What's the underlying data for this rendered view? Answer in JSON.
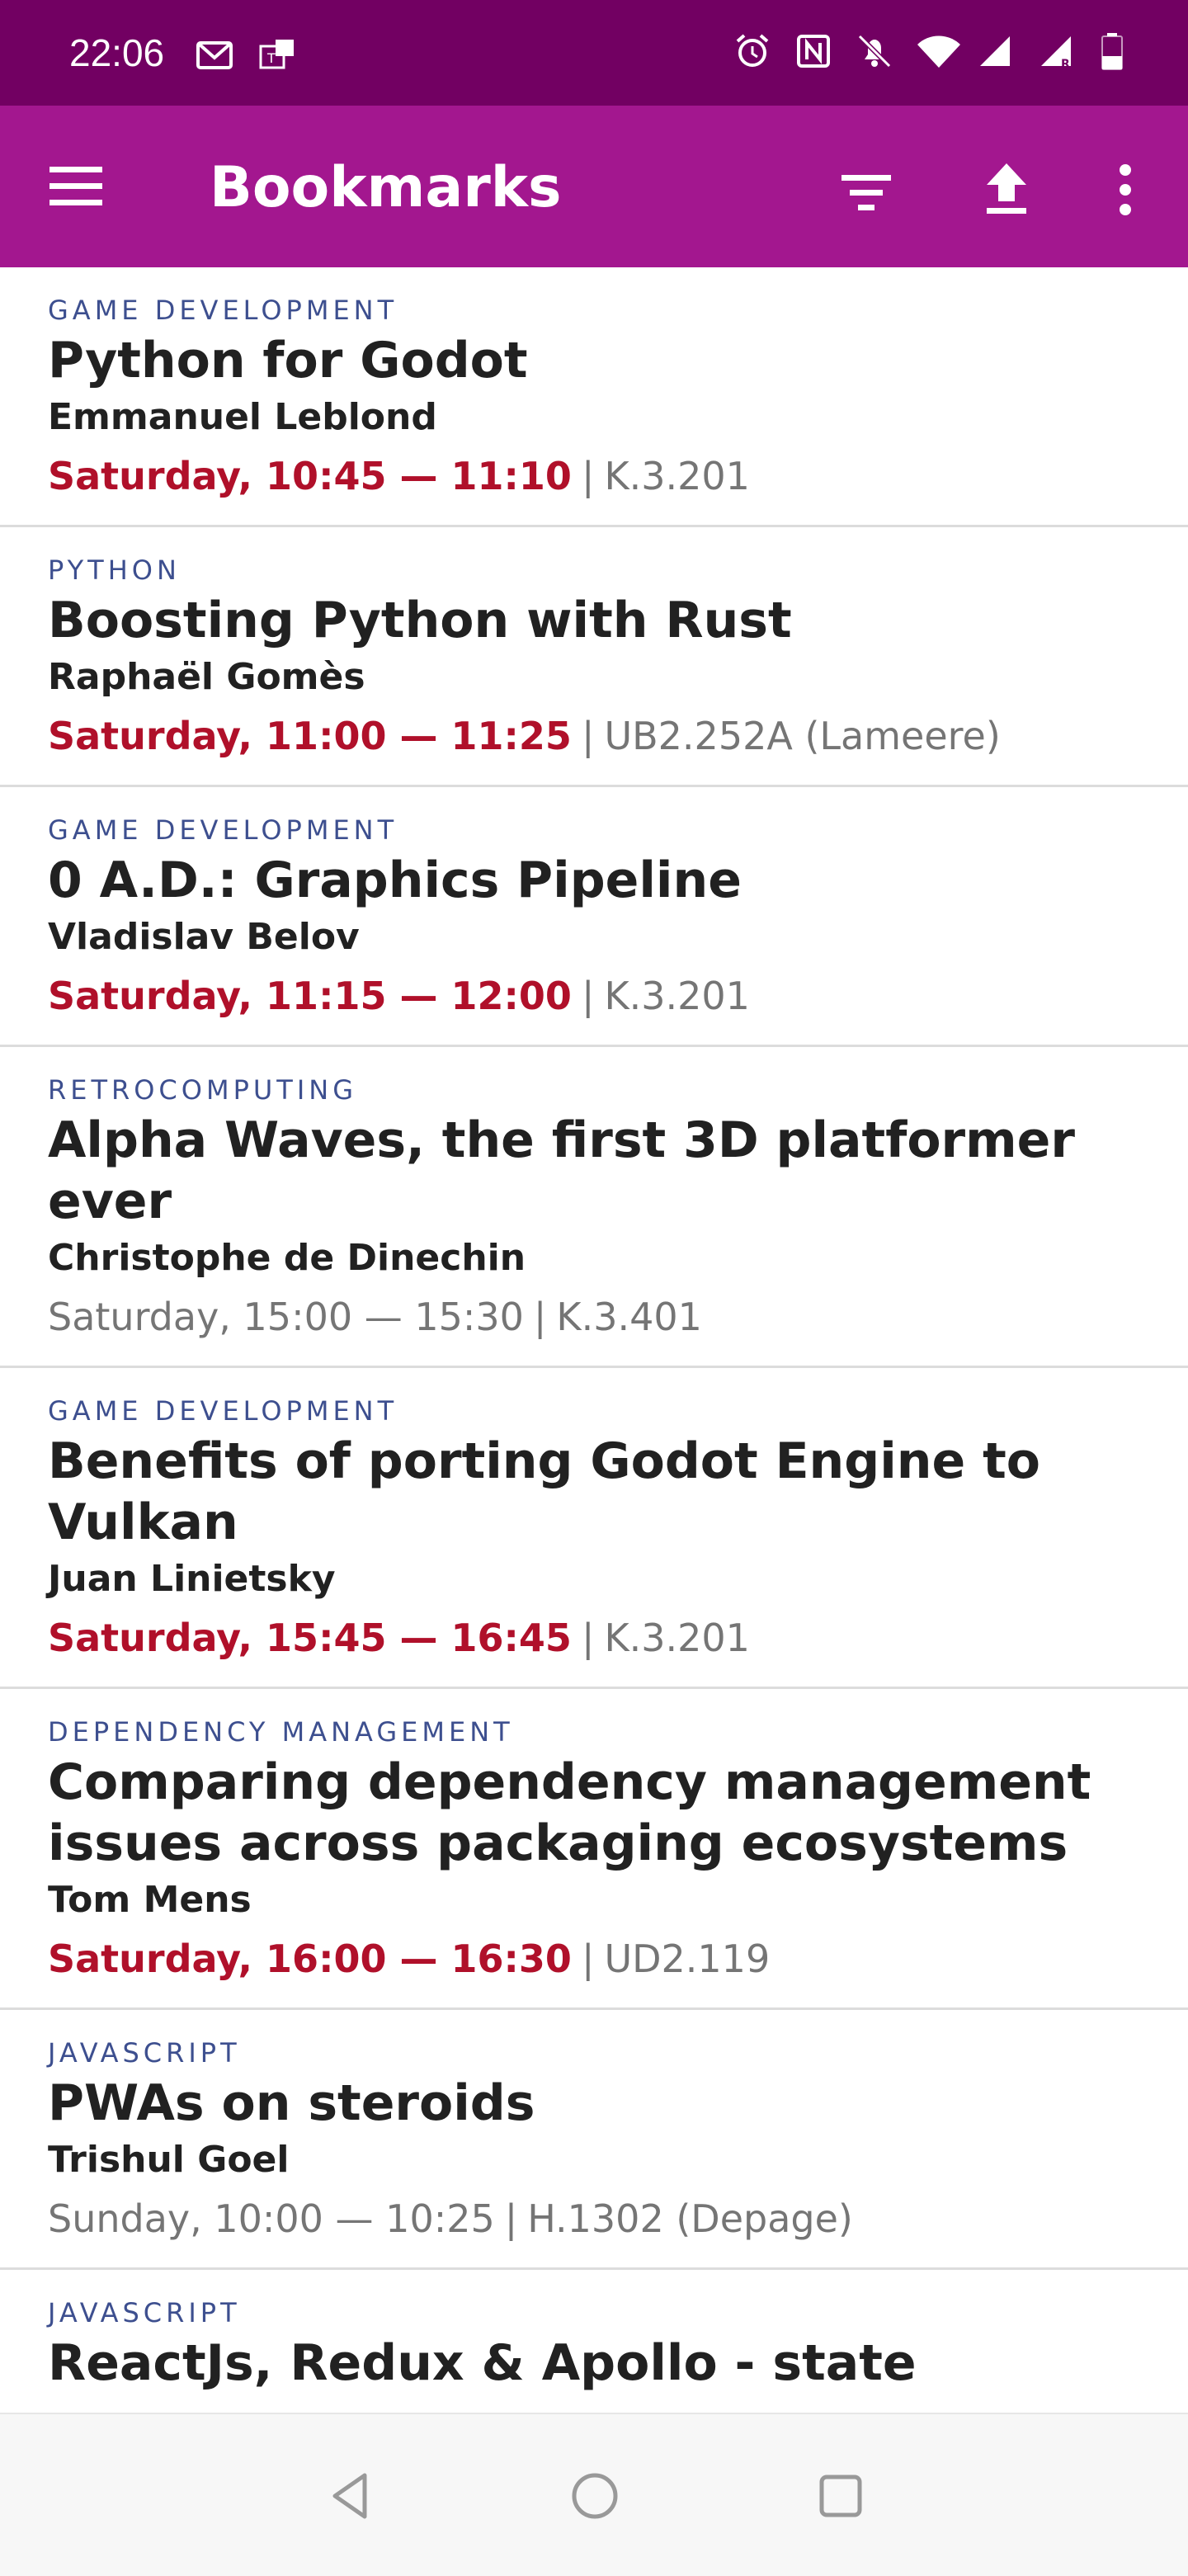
{
  "status_bar": {
    "time": "22:06",
    "left_icons": [
      "gmail-icon",
      "t-notification-icon"
    ],
    "right_icons": [
      "alarm-icon",
      "nfc-icon",
      "bell-off-icon",
      "wifi-icon",
      "signal-icon",
      "signal-roaming-icon",
      "battery-icon"
    ]
  },
  "app_bar": {
    "title": "Bookmarks",
    "background_color": "#a3178f"
  },
  "bookmarks": [
    {
      "track": "GAME DEVELOPMENT",
      "title": "Python for Godot",
      "speaker": "Emmanuel Leblond",
      "time": "Saturday, 10:45 — 11:10",
      "room": "K.3.201",
      "highlight": true
    },
    {
      "track": "PYTHON",
      "title": "Boosting Python with Rust",
      "speaker": "Raphaël Gomès",
      "time": "Saturday, 11:00 — 11:25",
      "room": "UB2.252A (Lameere)",
      "highlight": true
    },
    {
      "track": "GAME DEVELOPMENT",
      "title": "0 A.D.: Graphics Pipeline",
      "speaker": "Vladislav Belov",
      "time": "Saturday, 11:15 — 12:00",
      "room": "K.3.201",
      "highlight": true
    },
    {
      "track": "RETROCOMPUTING",
      "title": "Alpha Waves, the first 3D platformer ever",
      "speaker": "Christophe de Dinechin",
      "time": "Saturday, 15:00 — 15:30",
      "room": "K.3.401",
      "highlight": false
    },
    {
      "track": "GAME DEVELOPMENT",
      "title": "Benefits of porting Godot Engine to Vulkan",
      "speaker": "Juan Linietsky",
      "time": "Saturday, 15:45 — 16:45",
      "room": "K.3.201",
      "highlight": true
    },
    {
      "track": "DEPENDENCY MANAGEMENT",
      "title": "Comparing dependency management issues across packaging ecosystems",
      "speaker": "Tom Mens",
      "time": "Saturday, 16:00 — 16:30",
      "room": "UD2.119",
      "highlight": true
    },
    {
      "track": "JAVASCRIPT",
      "title": "PWAs on steroids",
      "speaker": "Trishul Goel",
      "time": "Sunday, 10:00 — 10:25",
      "room": "H.1302 (Depage)",
      "highlight": false
    },
    {
      "track": "JAVASCRIPT",
      "title": "ReactJs, Redux & Apollo - state",
      "speaker": "",
      "time": "",
      "room": "",
      "highlight": false
    }
  ],
  "colors": {
    "status_bar": "#720062",
    "track": "#3d4f8f",
    "time_highlight": "#b0102a",
    "muted": "#757575"
  },
  "nav_bar": {
    "icons": [
      "back-icon",
      "home-icon",
      "recents-icon"
    ]
  }
}
